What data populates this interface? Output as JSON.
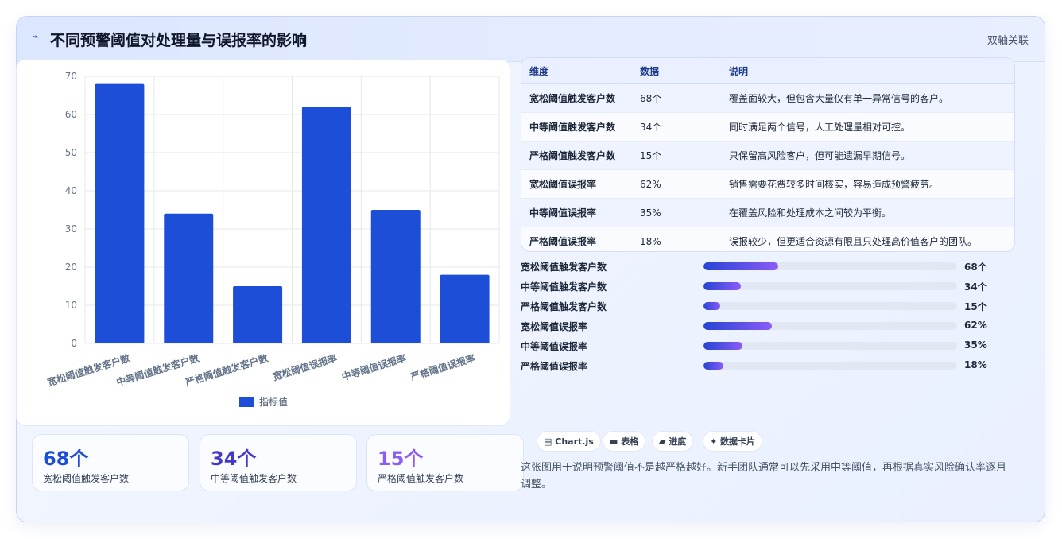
{
  "header": {
    "logo_glyph": "⌁",
    "title": "不同预警阈值对处理量与误报率的影响",
    "badge": "双轴关联"
  },
  "chart_data": {
    "type": "bar",
    "categories": [
      "宽松阈值触发客户数",
      "中等阈值触发客户数",
      "严格阈值触发客户数",
      "宽松阈值误报率",
      "中等阈值误报率",
      "严格阈值误报率"
    ],
    "series": [
      {
        "name": "指标值",
        "values": [
          68,
          34,
          15,
          62,
          35,
          18
        ],
        "color": "#1d4ed8"
      }
    ],
    "yticks": [
      0,
      10,
      20,
      30,
      40,
      50,
      60,
      70
    ],
    "ylim": [
      0,
      70
    ],
    "grid": true,
    "legend": "bottom"
  },
  "stats": [
    {
      "value": "68个",
      "label": "宽松阈值触发客户数",
      "color": "#1d4ed8"
    },
    {
      "value": "34个",
      "label": "中等阈值触发客户数",
      "color": "#4338ca"
    },
    {
      "value": "15个",
      "label": "严格阈值触发客户数",
      "color": "#8b5cf6"
    }
  ],
  "table": {
    "headers": [
      "维度",
      "数据",
      "说明"
    ],
    "rows": [
      [
        "宽松阈值触发客户数",
        "68个",
        "覆盖面较大，但包含大量仅有单一异常信号的客户。"
      ],
      [
        "中等阈值触发客户数",
        "34个",
        "同时满足两个信号，人工处理量相对可控。"
      ],
      [
        "严格阈值触发客户数",
        "15个",
        "只保留高风险客户，但可能遗漏早期信号。"
      ],
      [
        "宽松阈值误报率",
        "62%",
        "销售需要花费较多时间核实，容易造成预警疲劳。"
      ],
      [
        "中等阈值误报率",
        "35%",
        "在覆盖风险和处理成本之间较为平衡。"
      ],
      [
        "严格阈值误报率",
        "18%",
        "误报较少，但更适合资源有限且只处理高价值客户的团队。"
      ]
    ]
  },
  "progress": [
    {
      "label": "宽松阈值触发客户数",
      "value_text": "68个",
      "fraction": 0.295
    },
    {
      "label": "中等阈值触发客户数",
      "value_text": "34个",
      "fraction": 0.147
    },
    {
      "label": "严格阈值触发客户数",
      "value_text": "15个",
      "fraction": 0.066
    },
    {
      "label": "宽松阈值误报率",
      "value_text": "62%",
      "fraction": 0.27
    },
    {
      "label": "中等阈值误报率",
      "value_text": "35%",
      "fraction": 0.154
    },
    {
      "label": "严格阈值误报率",
      "value_text": "18%",
      "fraction": 0.079
    }
  ],
  "tags": [
    {
      "icon": "▤",
      "label": "Chart.js"
    },
    {
      "icon": "▬",
      "label": "表格"
    },
    {
      "icon": "▰",
      "label": "进度"
    },
    {
      "icon": "✦",
      "label": "数据卡片"
    }
  ],
  "note": "这张图用于说明预警阈值不是越严格越好。新手团队通常可以先采用中等阈值，再根据真实风险确认率逐月调整。"
}
